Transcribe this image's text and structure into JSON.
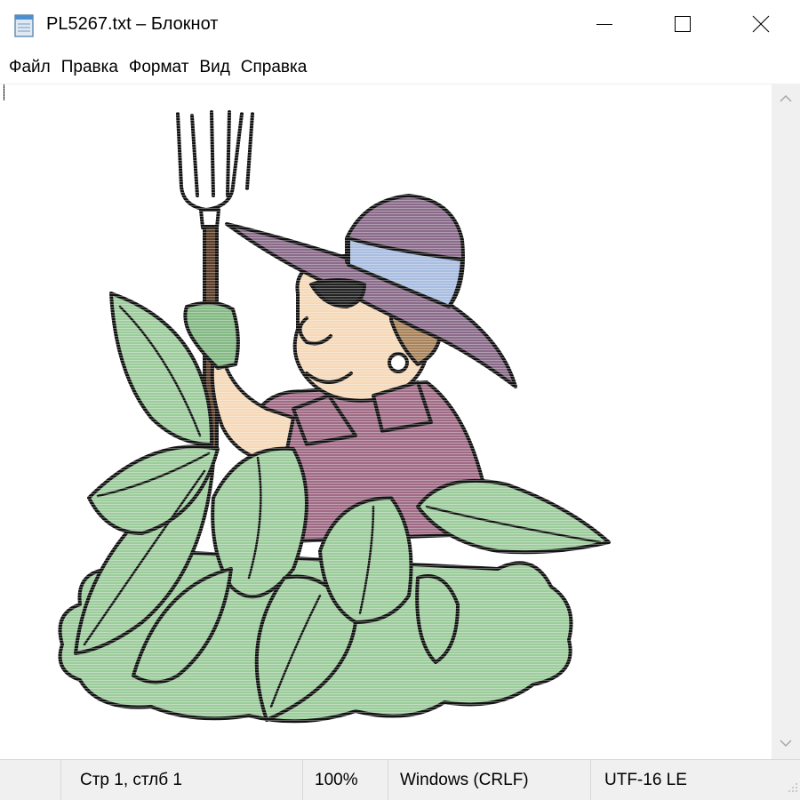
{
  "window": {
    "title": "PL5267.txt – Блокнот",
    "icons": {
      "app": "notepad-icon",
      "minimize": "minimize-icon",
      "maximize": "maximize-icon",
      "close": "close-icon"
    }
  },
  "menu": [
    "Файл",
    "Правка",
    "Формат",
    "Вид",
    "Справка"
  ],
  "status": {
    "position": "Стр 1, стлб 1",
    "zoom": "100%",
    "line_ending": "Windows (CRLF)",
    "encoding": "UTF-16 LE"
  },
  "colors": {
    "leaf": "#9ccc9c",
    "hat": "#8a6b8a",
    "shirt": "#a06b85",
    "skin": "#f5d8b8",
    "hair": "#a8825a",
    "hatband": "#a8bde0",
    "glove": "#84b884",
    "handle": "#5a3c28"
  }
}
